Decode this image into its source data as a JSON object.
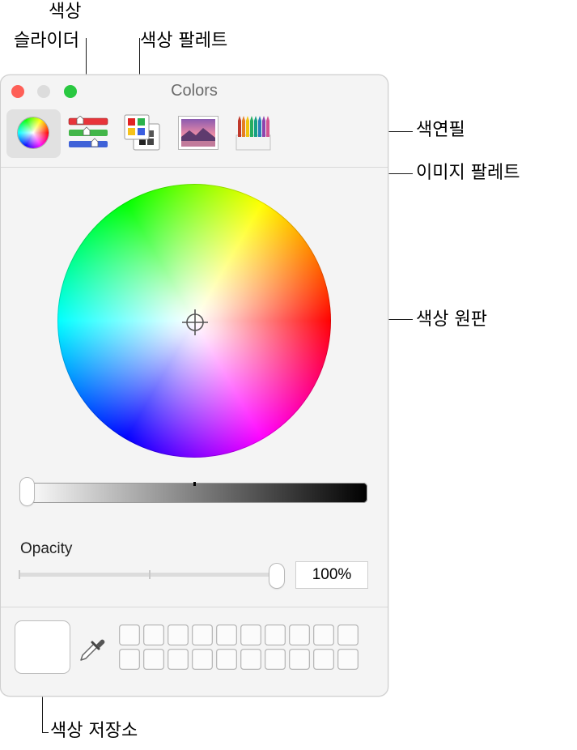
{
  "callouts": {
    "color_sliders_line1": "색상",
    "color_sliders_line2": "슬라이더",
    "color_palettes": "색상 팔레트",
    "pencils": "색연필",
    "image_palettes": "이미지 팔레트",
    "color_wheel": "색상 원판",
    "color_storage": "색상 저장소"
  },
  "window": {
    "title": "Colors"
  },
  "opacity": {
    "label": "Opacity",
    "value": "100%",
    "level": 1.0
  },
  "brightness": {
    "level": 0.0
  },
  "colors": {
    "close": "#fe5f57",
    "minimize_inactive": "#dcdcdc",
    "zoom": "#29c840",
    "current_color": "#ffffff"
  },
  "toolbar": {
    "items": [
      "color-wheel-icon",
      "color-sliders-icon",
      "color-palettes-icon",
      "image-palettes-icon",
      "pencils-icon"
    ]
  },
  "swatches": {
    "rows": 2,
    "columns": 10
  }
}
